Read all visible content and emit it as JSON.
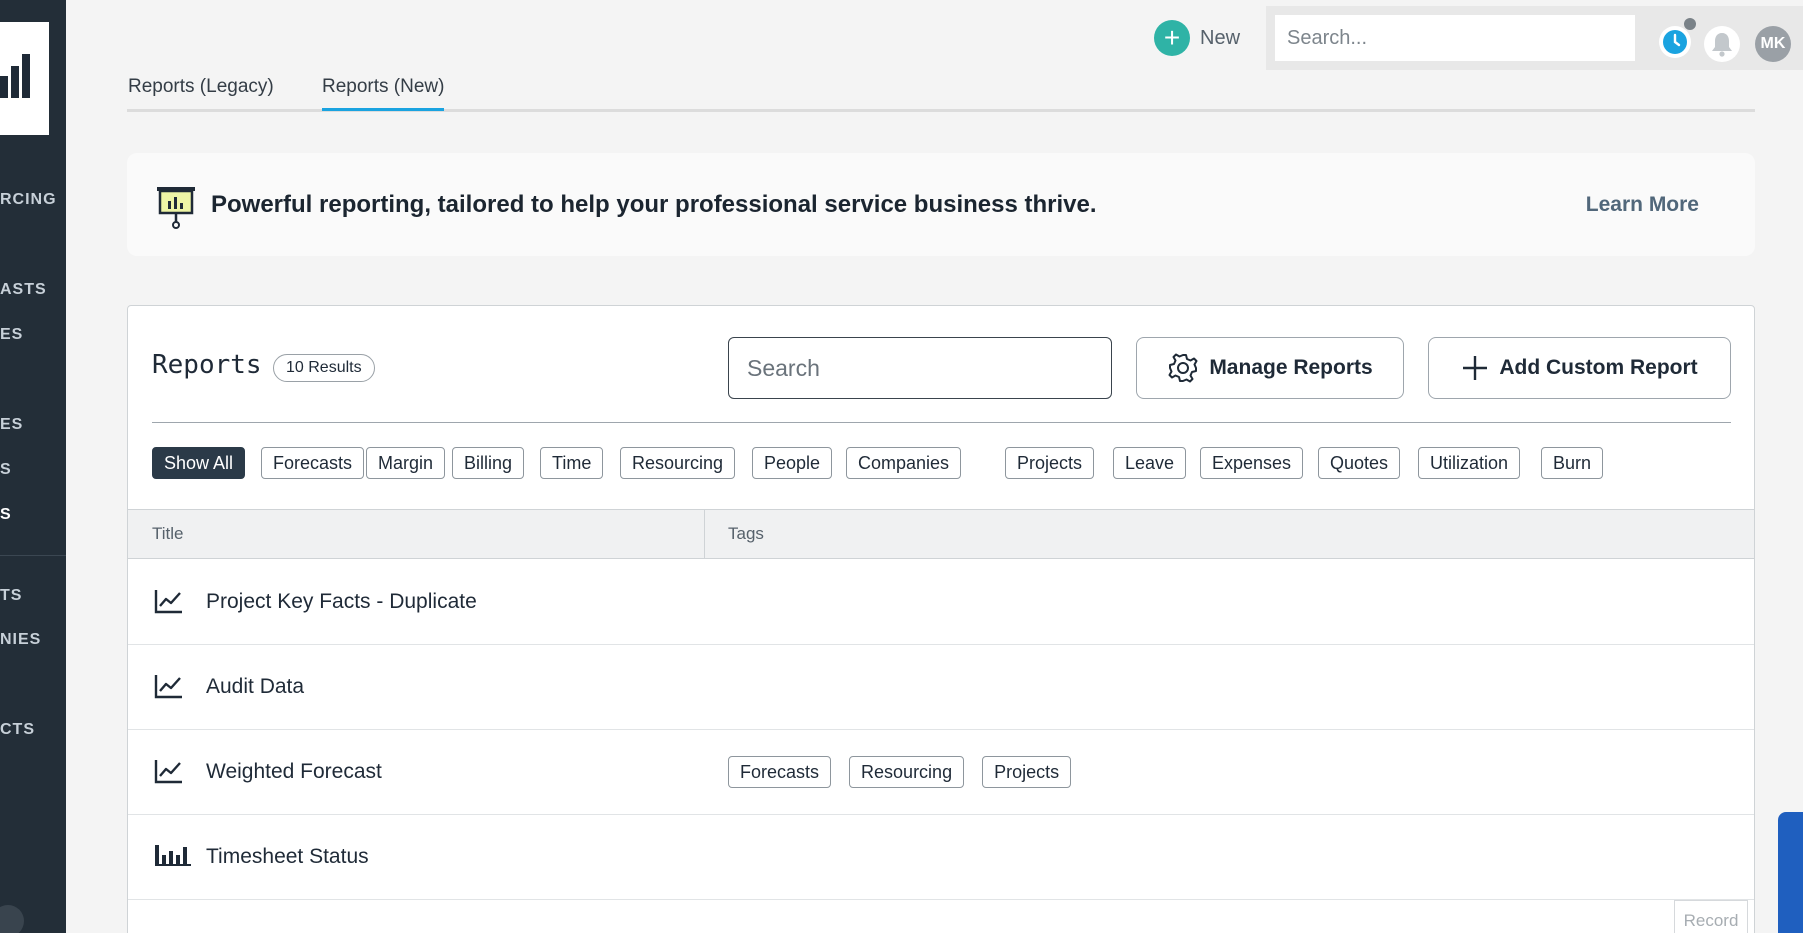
{
  "sidebar": {
    "items": [
      {
        "label": "RCING",
        "active": false
      },
      {
        "label": "ASTS",
        "active": false
      },
      {
        "label": "ES",
        "active": false
      },
      {
        "label": "ES",
        "active": false
      },
      {
        "label": "S",
        "active": false
      },
      {
        "label": "S",
        "active": true
      },
      {
        "label": "TS",
        "active": false
      },
      {
        "label": "NIES",
        "active": false
      },
      {
        "label": "CTS",
        "active": false
      }
    ]
  },
  "topbar": {
    "new_label": "New",
    "search_placeholder": "Search...",
    "avatar_initials": "MK"
  },
  "tabs": [
    {
      "label": "Reports (Legacy)",
      "active": false
    },
    {
      "label": "Reports (New)",
      "active": true
    }
  ],
  "banner": {
    "text": "Powerful reporting, tailored to help your professional service business thrive.",
    "learn_more": "Learn More"
  },
  "reports": {
    "title": "Reports",
    "result_count": "10 Results",
    "search_placeholder": "Search",
    "manage_label": "Manage Reports",
    "add_label": "Add Custom Report",
    "filters": [
      "Show All",
      "Forecasts",
      "Margin",
      "Billing",
      "Time",
      "Resourcing",
      "People",
      "Companies",
      "Projects",
      "Leave",
      "Expenses",
      "Quotes",
      "Utilization",
      "Burn"
    ],
    "active_filter": "Show All",
    "columns": {
      "title": "Title",
      "tags": "Tags"
    },
    "rows": [
      {
        "icon": "line-chart-icon",
        "title": "Project Key Facts - Duplicate",
        "tags": []
      },
      {
        "icon": "line-chart-icon",
        "title": "Audit Data",
        "tags": []
      },
      {
        "icon": "line-chart-icon",
        "title": "Weighted Forecast",
        "tags": [
          "Forecasts",
          "Resourcing",
          "Projects"
        ]
      },
      {
        "icon": "bar-chart-icon",
        "title": "Timesheet Status",
        "tags": []
      }
    ]
  },
  "record_label": "Record",
  "colors": {
    "sidebar_bg": "#232e38",
    "accent_tab": "#1aa3e0",
    "new_button": "#2fb3a6",
    "active_chip": "#2b3a48"
  }
}
